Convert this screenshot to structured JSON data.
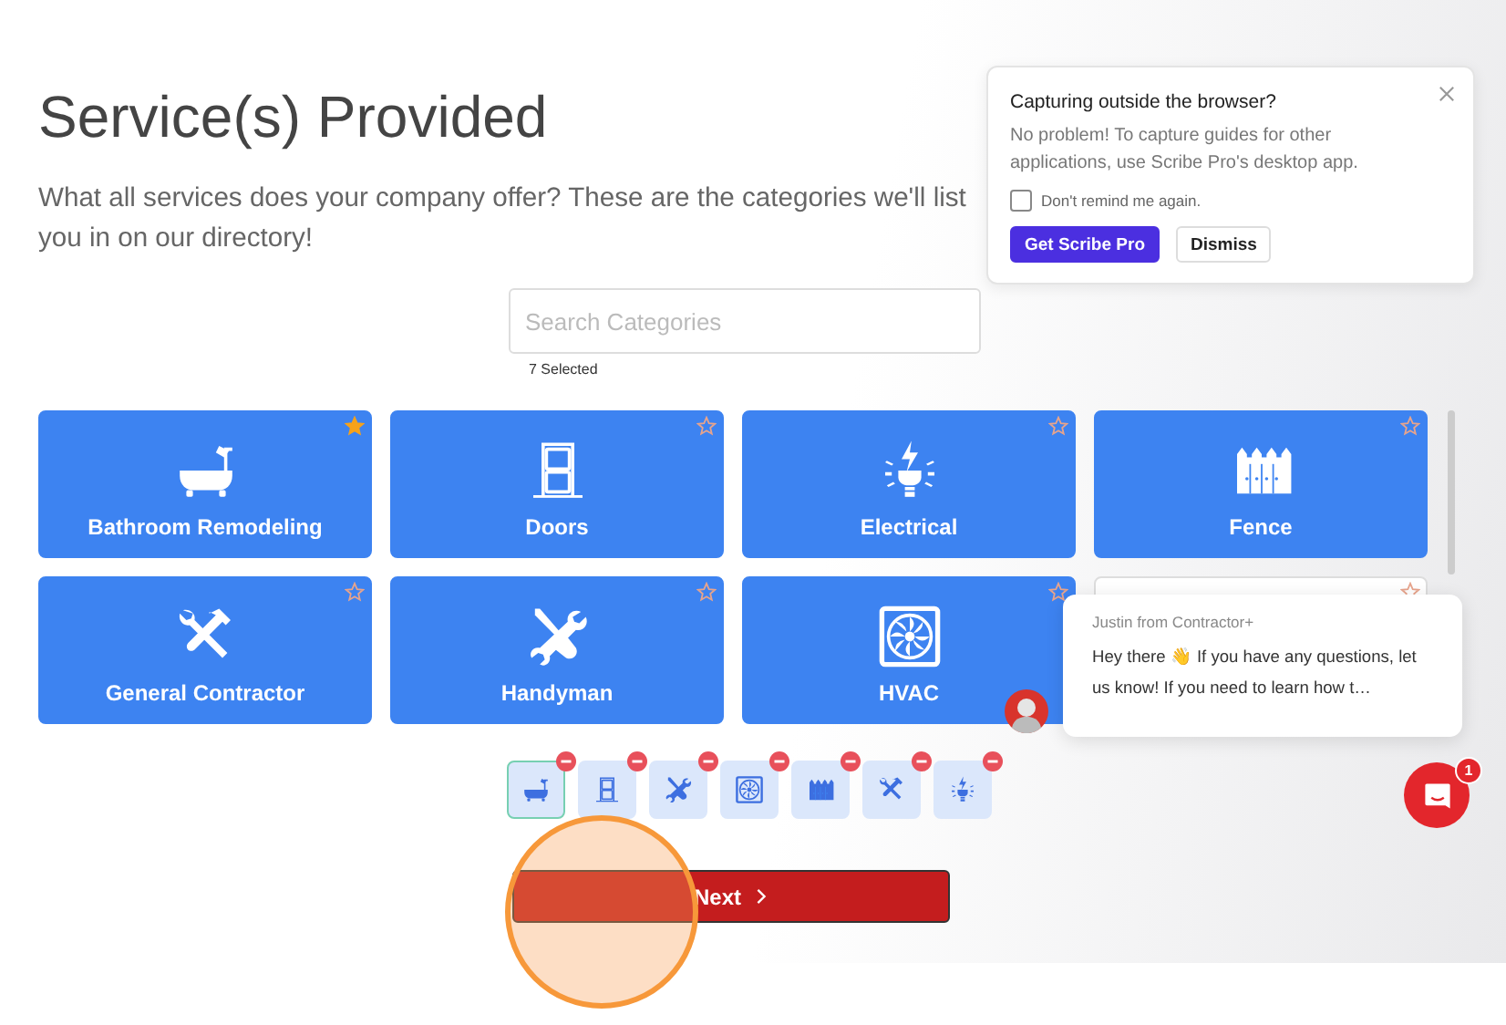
{
  "page": {
    "title": "Service(s) Provided",
    "description": "What all services does your company offer? These are the categories we'll list you in on our directory!"
  },
  "search": {
    "placeholder": "Search Categories",
    "count": "7 Selected"
  },
  "cards": [
    {
      "label": "Bathroom Remodeling",
      "kind": "bathtub",
      "selected": true,
      "starred": true
    },
    {
      "label": "Doors",
      "kind": "door",
      "selected": true,
      "starred": false
    },
    {
      "label": "Electrical",
      "kind": "electrical",
      "selected": true,
      "starred": false
    },
    {
      "label": "Fence",
      "kind": "fence",
      "selected": true,
      "starred": false
    },
    {
      "label": "General Contractor",
      "kind": "tools",
      "selected": true,
      "starred": false
    },
    {
      "label": "Handyman",
      "kind": "handyman",
      "selected": true,
      "starred": false
    },
    {
      "label": "HVAC",
      "kind": "fan",
      "selected": true,
      "starred": false
    },
    {
      "kind": "hidden",
      "selected": false,
      "starred": false
    }
  ],
  "chips": [
    {
      "kind": "bathtub",
      "selected": true
    },
    {
      "kind": "door",
      "selected": false
    },
    {
      "kind": "handyman",
      "selected": false
    },
    {
      "kind": "fan",
      "selected": false
    },
    {
      "kind": "fence",
      "selected": false
    },
    {
      "kind": "tools",
      "selected": false
    },
    {
      "kind": "electrical",
      "selected": false
    }
  ],
  "next_button": {
    "label": "Next"
  },
  "popup": {
    "title": "Capturing outside the browser?",
    "body": "No problem! To capture guides for other applications, use Scribe Pro's desktop app.",
    "checkbox": {
      "label": "Don't remind me again.",
      "checked": false
    },
    "buttons": [
      {
        "label": "Get Scribe Pro",
        "kind": "primary"
      },
      {
        "label": "Dismiss",
        "kind": "secondary"
      }
    ]
  },
  "chat": {
    "sender": "Justin from Contractor+",
    "message": "Hey there 👋 If you have any questions, let us know! If you need to learn how t…",
    "unread": "1"
  }
}
